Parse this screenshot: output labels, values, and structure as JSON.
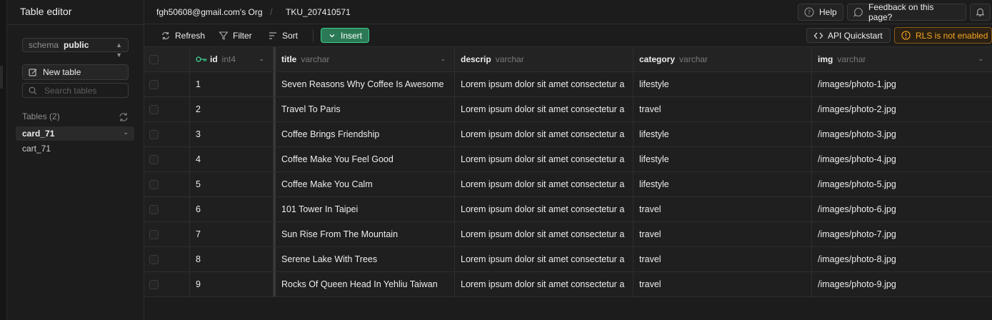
{
  "sidebar": {
    "title": "Table editor",
    "schema_label": "schema",
    "schema_value": "public",
    "new_table_label": "New table",
    "search_placeholder": "Search tables",
    "tables_heading": "Tables (2)",
    "tables": [
      "card_71",
      "cart_71"
    ],
    "active_table": "card_71"
  },
  "header": {
    "org": "fgh50608@gmail.com's Org",
    "separator": "/",
    "project": "TKU_207410571",
    "help_label": "Help",
    "feedback_label": "Feedback on this page?"
  },
  "toolbar": {
    "refresh_label": "Refresh",
    "filter_label": "Filter",
    "sort_label": "Sort",
    "insert_label": "Insert",
    "api_label": "API Quickstart",
    "rls_label": "RLS is not enabled"
  },
  "columns": [
    {
      "name": "id",
      "type": "int4",
      "primary_key": true
    },
    {
      "name": "title",
      "type": "varchar"
    },
    {
      "name": "descrip",
      "type": "varchar"
    },
    {
      "name": "category",
      "type": "varchar"
    },
    {
      "name": "img",
      "type": "varchar"
    }
  ],
  "rows": [
    {
      "id": "1",
      "title": "Seven Reasons Why Coffee Is Awesome",
      "descrip": "Lorem ipsum dolor sit amet consectetur a",
      "category": "lifestyle",
      "img": "/images/photo-1.jpg"
    },
    {
      "id": "2",
      "title": "Travel To Paris",
      "descrip": "Lorem ipsum dolor sit amet consectetur a",
      "category": "travel",
      "img": "/images/photo-2.jpg"
    },
    {
      "id": "3",
      "title": "Coffee Brings Friendship",
      "descrip": "Lorem ipsum dolor sit amet consectetur a",
      "category": "lifestyle",
      "img": "/images/photo-3.jpg"
    },
    {
      "id": "4",
      "title": "Coffee Make You Feel Good",
      "descrip": "Lorem ipsum dolor sit amet consectetur a",
      "category": "lifestyle",
      "img": "/images/photo-4.jpg"
    },
    {
      "id": "5",
      "title": "Coffee Make You Calm",
      "descrip": "Lorem ipsum dolor sit amet consectetur a",
      "category": "lifestyle",
      "img": "/images/photo-5.jpg"
    },
    {
      "id": "6",
      "title": "101 Tower In Taipei",
      "descrip": "Lorem ipsum dolor sit amet consectetur a",
      "category": "travel",
      "img": "/images/photo-6.jpg"
    },
    {
      "id": "7",
      "title": "Sun Rise From The Mountain",
      "descrip": "Lorem ipsum dolor sit amet consectetur a",
      "category": "travel",
      "img": "/images/photo-7.jpg"
    },
    {
      "id": "8",
      "title": "Serene Lake With Trees",
      "descrip": "Lorem ipsum dolor sit amet consectetur a",
      "category": "travel",
      "img": "/images/photo-8.jpg"
    },
    {
      "id": "9",
      "title": "Rocks Of Queen Head In Yehliu Taiwan",
      "descrip": "Lorem ipsum dolor sit amet consectetur a",
      "category": "travel",
      "img": "/images/photo-9.jpg"
    }
  ],
  "colors": {
    "background": "#1c1c1c",
    "accent_green": "#3ecf8e",
    "warning_orange": "#f5a623"
  }
}
